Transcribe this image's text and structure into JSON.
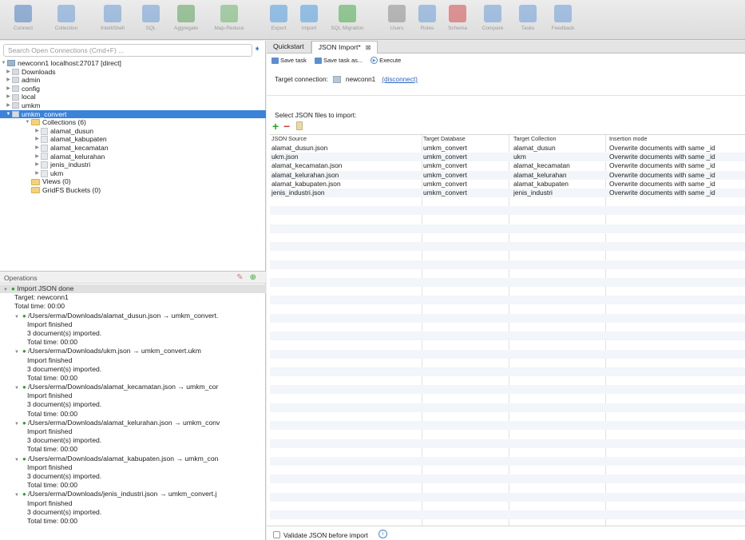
{
  "toolbar": {
    "buttons": [
      {
        "label": "Connect",
        "color": "#4a7fc1"
      },
      {
        "label": "Collection",
        "color": "#6a9ad6"
      },
      {
        "label": "IntelliShell",
        "color": "#6a9ad6"
      },
      {
        "label": "SQL",
        "color": "#6a9ad6"
      },
      {
        "label": "Aggregate",
        "color": "#5aa05a"
      },
      {
        "label": "Map-Reduce",
        "color": "#6cb26c"
      },
      {
        "label": "Export",
        "color": "#4a9ae0"
      },
      {
        "label": "Import",
        "color": "#4a9ae0"
      },
      {
        "label": "SQL Migration",
        "color": "#49a849"
      },
      {
        "label": "Users",
        "color": "#8a8a8a"
      },
      {
        "label": "Roles",
        "color": "#6a9ad6"
      },
      {
        "label": "Schema",
        "color": "#d04a4a"
      },
      {
        "label": "Compare",
        "color": "#6a9ad6"
      },
      {
        "label": "Tasks",
        "color": "#6a9ad6"
      },
      {
        "label": "Feedback",
        "color": "#6a9ad6"
      }
    ]
  },
  "left": {
    "search_placeholder": "Search Open Connections (Cmd+F) ...",
    "tree": {
      "connection": "newconn1 localhost:27017 [direct]",
      "databases": [
        "Downloads",
        "admin",
        "config",
        "local",
        "umkm"
      ],
      "selected_db": "umkm_convert",
      "collections_folder": "Collections (6)",
      "collections": [
        "alamat_dusun",
        "alamat_kabupaten",
        "alamat_kecamatan",
        "alamat_kelurahan",
        "jenis_industri",
        "ukm"
      ],
      "views": "Views (0)",
      "gridfs": "GridFS Buckets (0)"
    },
    "operations": {
      "header": "Operations",
      "title": "Import JSON done",
      "target": "Target: newconn1",
      "total": "Total time: 00:00",
      "items": [
        {
          "path": "/Users/erma/Downloads/alamat_dusun.json → umkm_convert.",
          "status": "Import finished",
          "count": "3 document(s) imported.",
          "time": "Total time: 00:00"
        },
        {
          "path": "/Users/erma/Downloads/ukm.json → umkm_convert.ukm",
          "status": "Import finished",
          "count": "3 document(s) imported.",
          "time": "Total time: 00:00"
        },
        {
          "path": "/Users/erma/Downloads/alamat_kecamatan.json → umkm_cor",
          "status": "Import finished",
          "count": "3 document(s) imported.",
          "time": "Total time: 00:00"
        },
        {
          "path": "/Users/erma/Downloads/alamat_kelurahan.json → umkm_conv",
          "status": "Import finished",
          "count": "3 document(s) imported.",
          "time": "Total time: 00:00"
        },
        {
          "path": "/Users/erma/Downloads/alamat_kabupaten.json → umkm_con",
          "status": "Import finished",
          "count": "3 document(s) imported.",
          "time": "Total time: 00:00"
        },
        {
          "path": "/Users/erma/Downloads/jenis_industri.json → umkm_convert.j",
          "status": "Import finished",
          "count": "3 document(s) imported.",
          "time": "Total time: 00:00"
        }
      ]
    }
  },
  "right": {
    "tabs": [
      {
        "label": "Quickstart"
      },
      {
        "label": "JSON Import*",
        "close": "⊠"
      }
    ],
    "actions": {
      "save": "Save task",
      "save_as": "Save task as...",
      "execute": "Execute"
    },
    "target_label": "Target connection:",
    "target_conn": "newconn1",
    "disconnect": "(disconnect)",
    "select_label": "Select JSON files to import:",
    "columns": [
      "JSON Source",
      "Target Database",
      "Target Collection",
      "Insertion mode"
    ],
    "rows": [
      [
        "alamat_dusun.json",
        "umkm_convert",
        "alamat_dusun",
        "Overwrite documents with same _id"
      ],
      [
        "ukm.json",
        "umkm_convert",
        "ukm",
        "Overwrite documents with same _id"
      ],
      [
        "alamat_kecamatan.json",
        "umkm_convert",
        "alamat_kecamatan",
        "Overwrite documents with same _id"
      ],
      [
        "alamat_kelurahan.json",
        "umkm_convert",
        "alamat_kelurahan",
        "Overwrite documents with same _id"
      ],
      [
        "alamat_kabupaten.json",
        "umkm_convert",
        "alamat_kabupaten",
        "Overwrite documents with same _id"
      ],
      [
        "jenis_industri.json",
        "umkm_convert",
        "jenis_industri",
        "Overwrite documents with same _id"
      ]
    ],
    "validate_label": "Validate JSON before import"
  }
}
